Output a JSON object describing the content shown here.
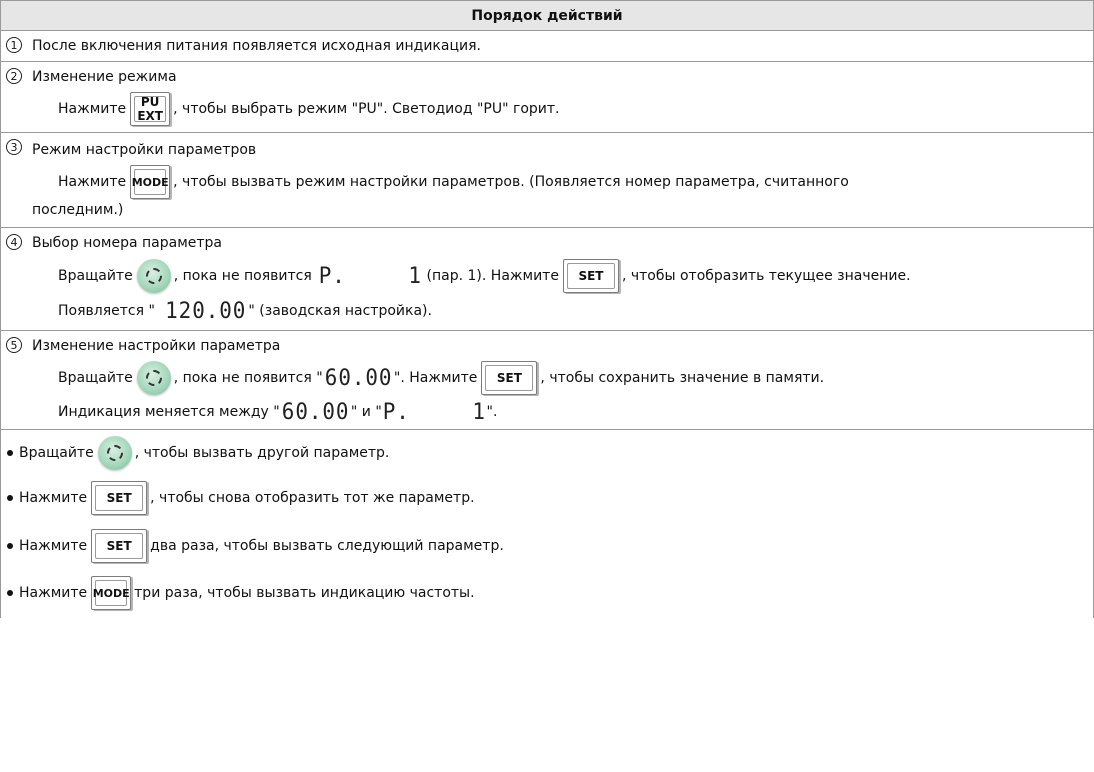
{
  "header": {
    "title": "Порядок действий"
  },
  "steps": [
    {
      "num": "1",
      "title": "После включения питания появляется исходная индикация."
    },
    {
      "num": "2",
      "title": "Изменение режима",
      "press": "Нажмите",
      "key_top": "PU",
      "key_bottom": "EXT",
      "after": ", чтобы выбрать режим \"PU\". Светодиод \"PU\" горит."
    },
    {
      "num": "3",
      "title": "Режим настройки параметров",
      "press": "Нажмите",
      "key": "MODE",
      "after": ", чтобы вызвать режим настройки параметров. (Появляется номер параметра, считанного",
      "cont": "последним.)"
    },
    {
      "num": "4",
      "title": "Выбор номера параметра",
      "rotate": "Вращайте",
      "until": ", пока не появится",
      "display_p": "P.",
      "display_1": "1",
      "par": "(пар. 1). Нажмите",
      "key": "SET",
      "after": ", чтобы отобразить текущее значение.",
      "appears_pre": "Появляется \"",
      "display_val": "120.00",
      "appears_post": "\" (заводская настройка)."
    },
    {
      "num": "5",
      "title": "Изменение настройки параметра",
      "rotate": "Вращайте",
      "until": ", пока не появится \"",
      "display_val": "60.00",
      "mid": "\". Нажмите",
      "key": "SET",
      "after": ", чтобы сохранить значение в памяти.",
      "alt_pre": "Индикация меняется между \"",
      "alt_val": "60.00",
      "alt_mid": "\" и \"",
      "alt_p": "P.",
      "alt_1": "1",
      "alt_post": "\"."
    }
  ],
  "bullets": [
    {
      "pre": "Вращайте",
      "post": ", чтобы вызвать другой параметр."
    },
    {
      "pre": "Нажмите",
      "key": "SET",
      "post": ", чтобы снова отобразить тот же параметр."
    },
    {
      "pre": "Нажмите",
      "key": "SET",
      "post": "два раза, чтобы вызвать следующий параметр."
    },
    {
      "pre": "Нажмите",
      "key": "MODE",
      "post": "три раза, чтобы вызвать индикацию частоты."
    }
  ]
}
